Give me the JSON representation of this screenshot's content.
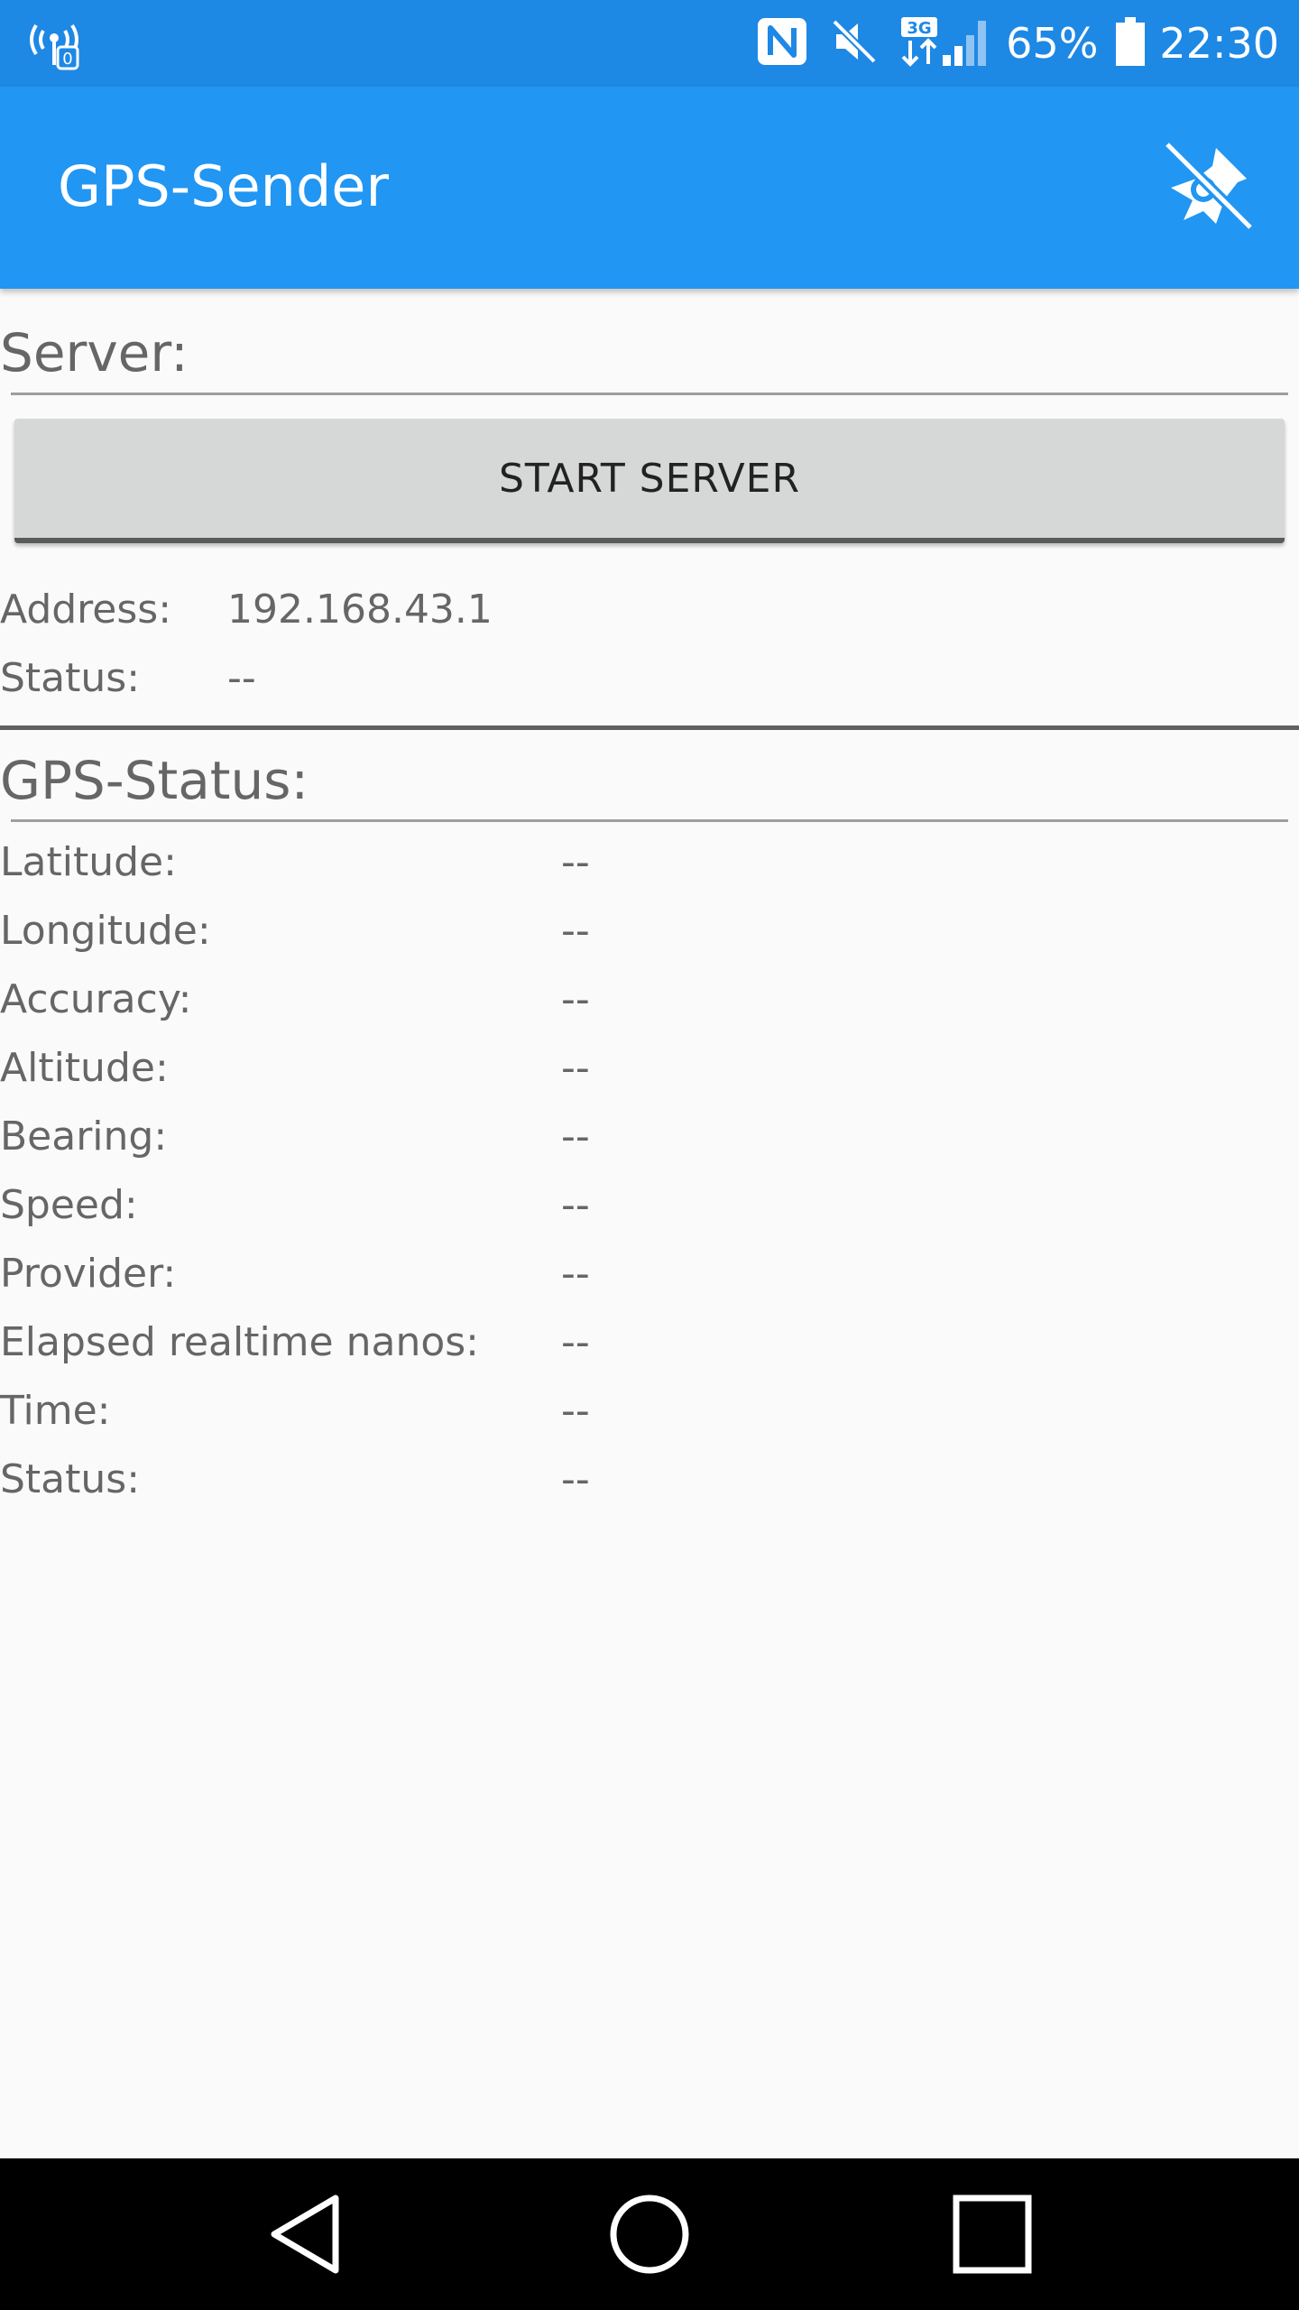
{
  "status_bar": {
    "battery_percent": "65%",
    "time": "22:30",
    "network_type": "3G",
    "icons": [
      "hotspot-icon",
      "nfc-icon",
      "mute-icon",
      "mobile-data-icon",
      "signal-icon",
      "battery-icon"
    ]
  },
  "app_bar": {
    "title": "GPS-Sender",
    "action_icon": "location-off-icon"
  },
  "server_section": {
    "title": "Server:",
    "start_button_label": "START SERVER",
    "address_label": "Address:",
    "address_value": "192.168.43.1",
    "status_label": "Status:",
    "status_value": "--"
  },
  "gps_section": {
    "title": "GPS-Status:",
    "rows": [
      {
        "label": "Latitude:",
        "value": "--"
      },
      {
        "label": "Longitude:",
        "value": "--"
      },
      {
        "label": "Accuracy:",
        "value": "--"
      },
      {
        "label": "Altitude:",
        "value": "--"
      },
      {
        "label": "Bearing:",
        "value": "--"
      },
      {
        "label": "Speed:",
        "value": "--"
      },
      {
        "label": "Provider:",
        "value": "--"
      },
      {
        "label": "Elapsed realtime nanos:",
        "value": "--"
      },
      {
        "label": "Time:",
        "value": "--"
      },
      {
        "label": "Status:",
        "value": "--"
      }
    ]
  },
  "nav_bar": {
    "icons": [
      "back-icon",
      "home-icon",
      "recents-icon"
    ]
  },
  "colors": {
    "status_bar": "#1e88e5",
    "app_bar": "#2196f3",
    "background": "#fafafa",
    "button": "#d6d7d7",
    "text": "#666666"
  }
}
